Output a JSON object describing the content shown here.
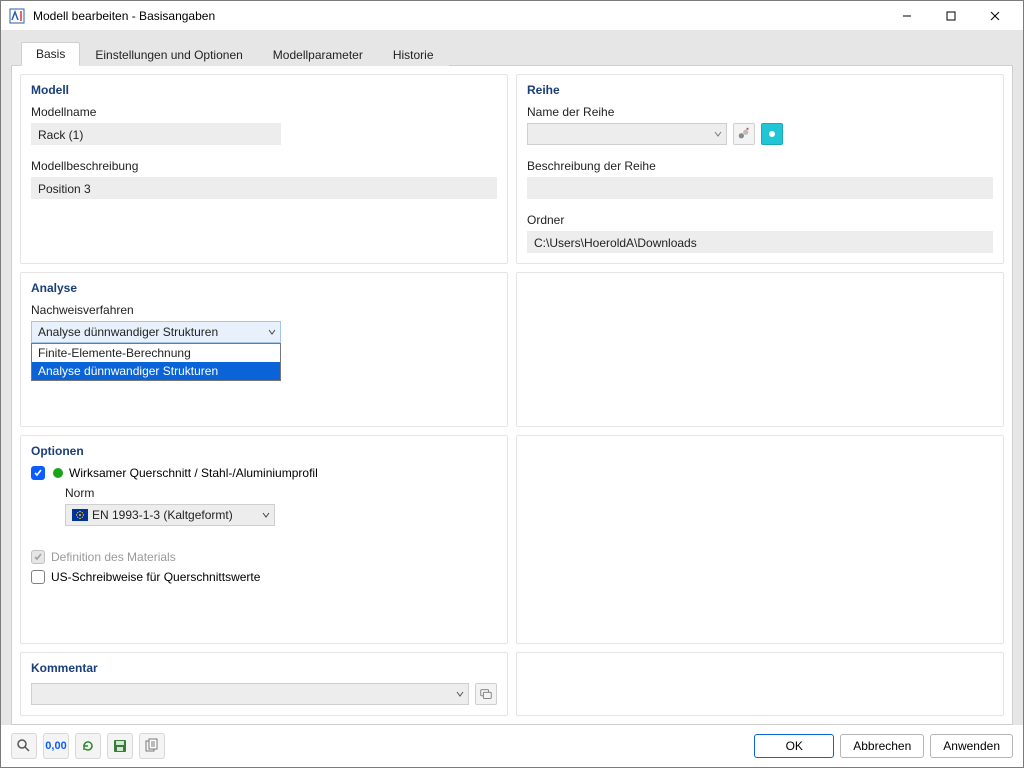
{
  "window": {
    "title": "Modell bearbeiten - Basisangaben"
  },
  "tabs": {
    "t0": "Basis",
    "t1": "Einstellungen und Optionen",
    "t2": "Modellparameter",
    "t3": "Historie"
  },
  "modell": {
    "group_title": "Modell",
    "name_label": "Modellname",
    "name_value": "Rack (1)",
    "desc_label": "Modellbeschreibung",
    "desc_value": "Position 3"
  },
  "reihe": {
    "group_title": "Reihe",
    "name_label": "Name der Reihe",
    "name_value": "",
    "desc_label": "Beschreibung der Reihe",
    "desc_value": "",
    "folder_label": "Ordner",
    "folder_value": "C:\\Users\\HoeroldA\\Downloads"
  },
  "analyse": {
    "group_title": "Analyse",
    "method_label": "Nachweisverfahren",
    "method_selected": "Analyse dünnwandiger Strukturen",
    "options": {
      "o0": "Finite-Elemente-Berechnung",
      "o1": "Analyse dünnwandiger Strukturen"
    }
  },
  "optionen": {
    "group_title": "Optionen",
    "eff_label": "Wirksamer Querschnitt / Stahl-/Aluminiumprofil",
    "norm_label": "Norm",
    "norm_value": "EN 1993-1-3 (Kaltgeformt)",
    "mat_label": "Definition des Materials",
    "us_label": "US-Schreibweise für Querschnittswerte"
  },
  "kommentar": {
    "group_title": "Kommentar"
  },
  "footer": {
    "ok": "OK",
    "cancel": "Abbrechen",
    "apply": "Anwenden",
    "tool_decimal": "0,00"
  }
}
